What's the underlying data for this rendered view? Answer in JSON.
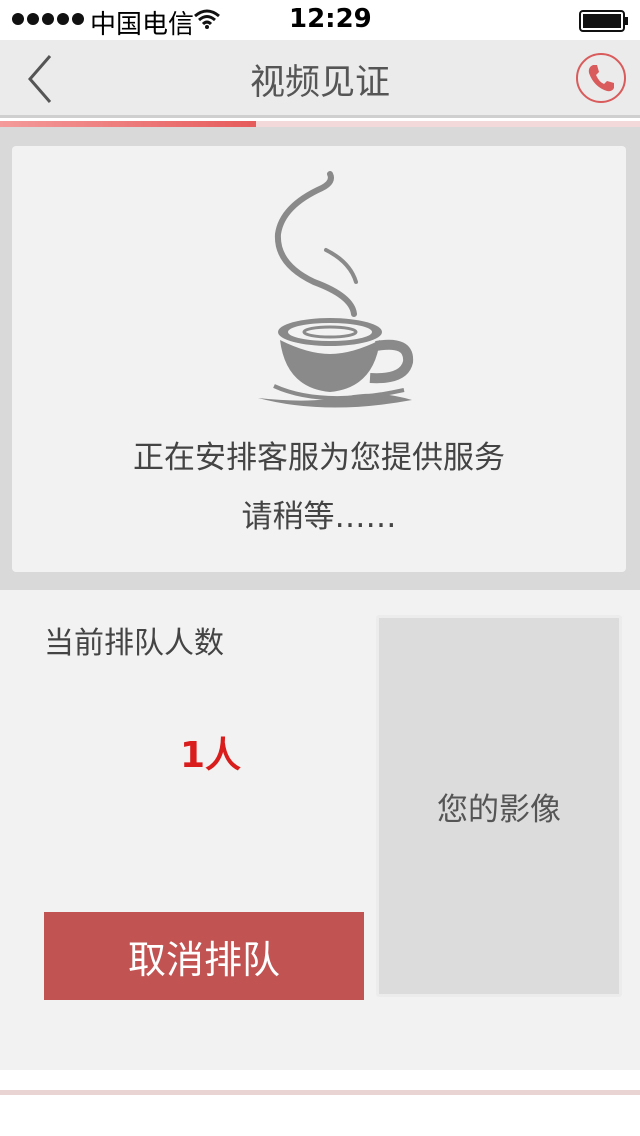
{
  "status_bar": {
    "carrier": "中国电信",
    "time": "12:29"
  },
  "nav": {
    "title": "视频见证",
    "back_icon": "chevron-left-icon",
    "call_icon": "phone-icon"
  },
  "progress": {
    "value_percent": 40
  },
  "waiting": {
    "icon": "coffee-cup-icon",
    "message": "正在安排客服为您提供服务",
    "sub_message": "请稍等……"
  },
  "queue": {
    "label": "当前排队人数",
    "count": "1人",
    "cancel_label": "取消排队",
    "preview_label": "您的影像"
  },
  "colors": {
    "accent": "#c25353",
    "count_red": "#d91c1c",
    "progress": "#e65b5b"
  }
}
